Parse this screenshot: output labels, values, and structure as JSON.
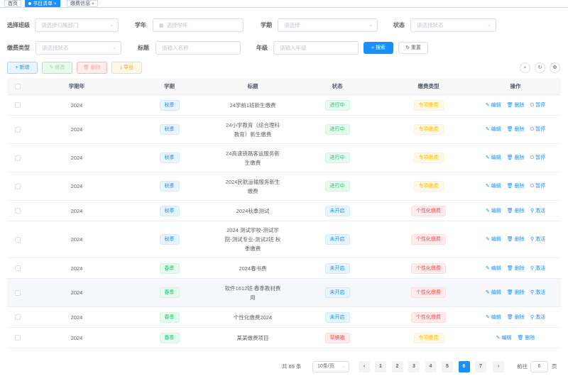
{
  "tabs": [
    {
      "label": "首页",
      "active": false
    },
    {
      "label": "书目清单",
      "active": true
    },
    {
      "label": "缴费信息",
      "active": false
    }
  ],
  "filters": {
    "class_label": "选择班级",
    "class_placeholder": "请选择归属部门",
    "year_label": "学年",
    "year_placeholder": "选择学年",
    "term_label": "学期",
    "term_placeholder": "请选择",
    "status_label": "状态",
    "status_placeholder": "请选择状态",
    "fee_type_label": "缴费类型",
    "fee_type_placeholder": "请选择状态",
    "title_label": "标题",
    "title_placeholder": "请输入名称",
    "grade_label": "年级",
    "grade_placeholder": "请输入年级",
    "search_label": "搜索",
    "reset_label": "重置"
  },
  "toolbar": {
    "add_label": "新增",
    "edit_label": "修改",
    "delete_label": "删除",
    "export_label": "导出"
  },
  "table": {
    "headers": [
      "学期年",
      "学期",
      "标题",
      "状态",
      "缴费类型",
      "操作"
    ],
    "rows": [
      {
        "year": "2024",
        "term": "秋季",
        "title": "24学前1班新生缴费",
        "status": "进行中",
        "fee_type": "专项缴费",
        "a1": "编辑",
        "a2": "删除",
        "a3": "暂停"
      },
      {
        "year": "2024",
        "term": "秋季",
        "title": "24小学教育（综合理科教育）新生缴费",
        "status": "进行中",
        "fee_type": "专项缴费",
        "a1": "编辑",
        "a2": "删除",
        "a3": "暂停"
      },
      {
        "year": "2024",
        "term": "秋季",
        "title": "24高速铁路客运服务新生缴费",
        "status": "进行中",
        "fee_type": "专项缴费",
        "a1": "编辑",
        "a2": "删除",
        "a3": "暂停"
      },
      {
        "year": "2024",
        "term": "秋季",
        "title": "2024民航运输服务新生缴费",
        "status": "进行中",
        "fee_type": "专项缴费",
        "a1": "编辑",
        "a2": "删除",
        "a3": "暂停"
      },
      {
        "year": "2024",
        "term": "秋季",
        "title": "2024秋季测试",
        "status": "未开启",
        "fee_type": "个性化缴费",
        "a1": "编辑",
        "a2": "删除",
        "a3": "激活"
      },
      {
        "year": "2024",
        "term": "秋季",
        "title": "2024 测试学校-测试学院-测试专业-测试2班 秋季缴费",
        "status": "未开启",
        "fee_type": "个性化缴费",
        "a1": "编辑",
        "a2": "删除",
        "a3": "激活"
      },
      {
        "year": "2024",
        "term": "春季",
        "title": "2024春书费",
        "status": "未开启",
        "fee_type": "个性化缴费",
        "a1": "编辑",
        "a2": "删除",
        "a3": "激活"
      },
      {
        "year": "2024",
        "term": "春季",
        "title": "软件1612班 春季教材费用",
        "status": "未开启",
        "fee_type": "个性化缴费",
        "a1": "编辑",
        "a2": "删除",
        "a3": "激活"
      },
      {
        "year": "2024",
        "term": "春季",
        "title": "个性化缴费2024",
        "status": "未开启",
        "fee_type": "个性化缴费",
        "a1": "编辑",
        "a2": "删除",
        "a3": "激活"
      },
      {
        "year": "2024",
        "term": "春季",
        "title": "某某缴费项目",
        "status": "草稿箱",
        "fee_type": "专项缴费",
        "a1": "编辑",
        "a2": "删除",
        "a3": ""
      }
    ]
  },
  "pagination": {
    "total_text": "共 69 条",
    "page_size": "10条/页",
    "pages": [
      "1",
      "2",
      "3",
      "4",
      "5",
      "6",
      "7"
    ],
    "current_page": "6",
    "goto_label": "前往",
    "goto_value": "6",
    "page_suffix": "页"
  },
  "colors": {
    "primary": "#1890ff",
    "success": "#13ce66",
    "danger": "#ff4949",
    "warning": "#ffba00"
  }
}
